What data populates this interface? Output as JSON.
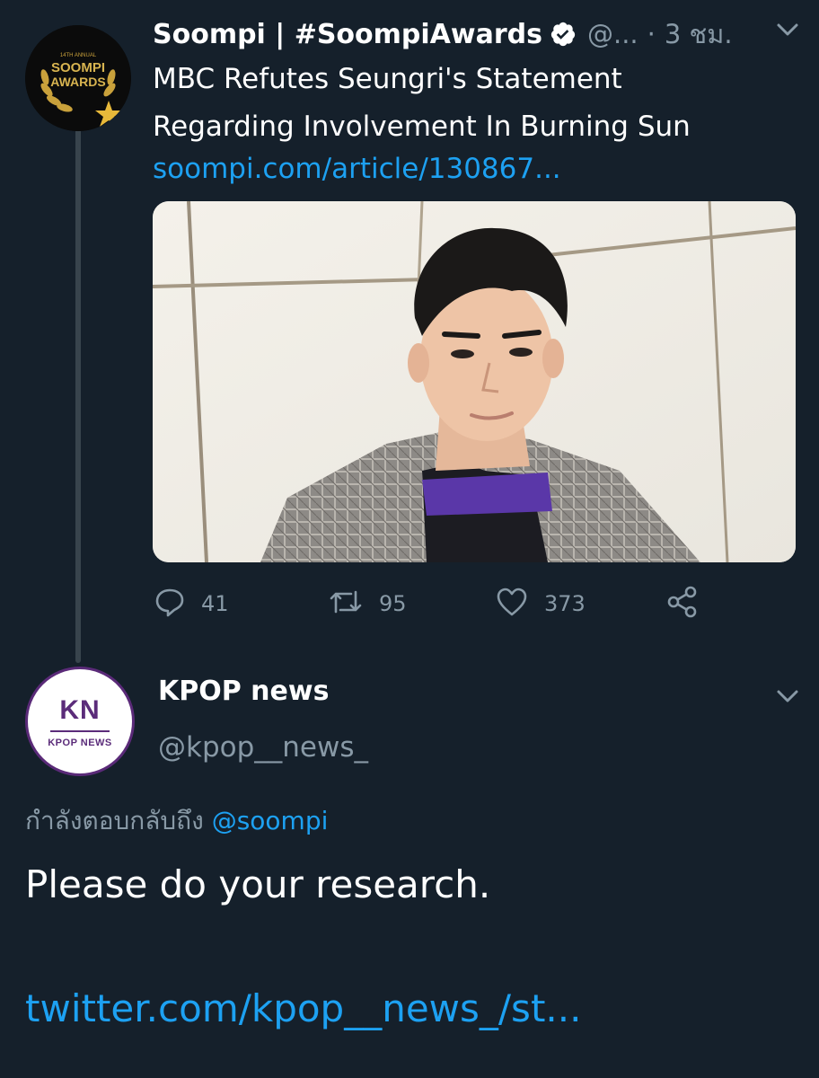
{
  "tweet1": {
    "display_name": "Soompi | #SoompiAwards",
    "handle": "@...",
    "separator": "·",
    "time": "3 ชม.",
    "text_line1": "MBC Refutes Seungri's Statement",
    "text_line2": "Regarding Involvement In Burning Sun",
    "link": "soompi.com/article/130867...",
    "avatar_text": {
      "top": "14TH ANNUAL",
      "line1": "SOOMPI",
      "line2": "AWARDS"
    },
    "stats": {
      "replies": "41",
      "retweets": "95",
      "likes": "373"
    },
    "icons": [
      "verified-icon",
      "chevron-down-icon",
      "reply-icon",
      "retweet-icon",
      "like-icon",
      "share-icon"
    ]
  },
  "tweet2": {
    "display_name": "KPOP news",
    "handle": "@kpop__news_",
    "avatar_text": {
      "initials": "KN",
      "subtitle": "KPOP NEWS"
    },
    "replying_prefix": "กำลังตอบกลับถึง",
    "replying_to": "@soompi",
    "body": "Please do your research.",
    "link": "twitter.com/kpop__news_/st..."
  },
  "colors": {
    "background": "#15202b",
    "secondary_text": "#8899a6",
    "link": "#1da1f2",
    "thread_line": "#38444d",
    "kn_purple": "#5b2c7a"
  }
}
